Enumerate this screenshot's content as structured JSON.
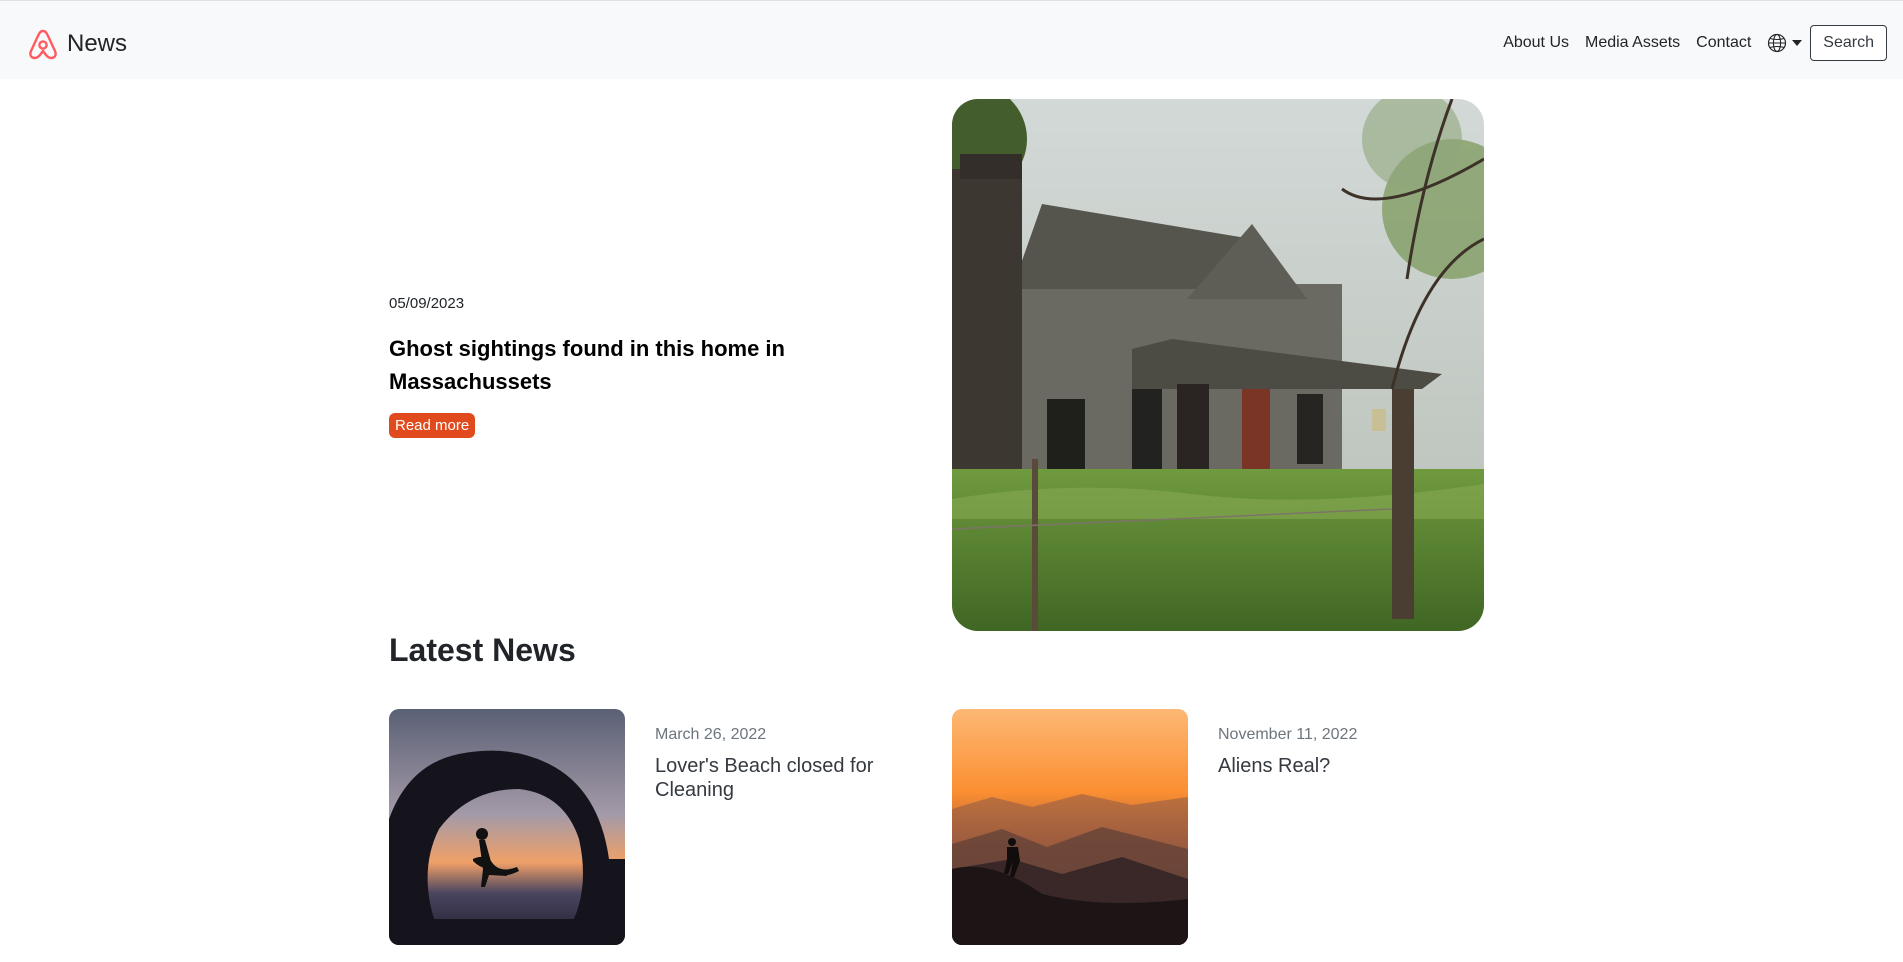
{
  "nav": {
    "brand": "News",
    "links": [
      "About Us",
      "Media Assets",
      "Contact"
    ],
    "language_icon": "globe-icon",
    "search_label": "Search"
  },
  "hero": {
    "date": "05/09/2023",
    "title": "Ghost sightings found in this home in Massachussets",
    "cta_label": "Read more",
    "image_desc": "abandoned-wooden-farmhouse"
  },
  "latest": {
    "title": "Latest News",
    "items": [
      {
        "date": "March 26, 2022",
        "title": "Lover's Beach closed for Cleaning",
        "image_desc": "couple-silhouette-sunset-beach"
      },
      {
        "date": "November 11, 2022",
        "title": "Aliens Real?",
        "image_desc": "hiker-silhouette-mountain-sunset"
      }
    ]
  },
  "colors": {
    "accent": "#e04a1c",
    "logo": "#ff5a5f",
    "navbar_bg": "#f8f9fa"
  }
}
